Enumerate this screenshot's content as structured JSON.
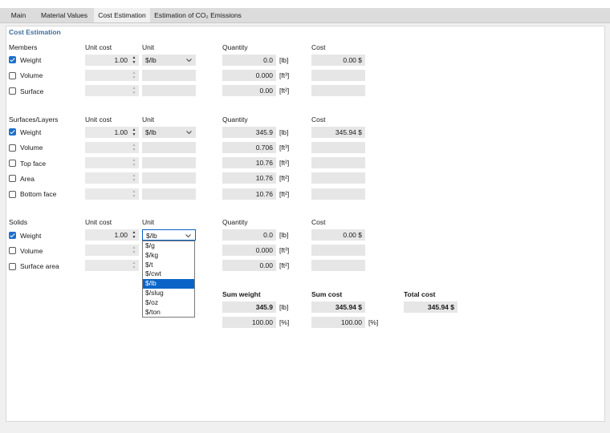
{
  "tabs": [
    {
      "label": "Main",
      "active": false
    },
    {
      "label": "Material Values",
      "active": false
    },
    {
      "label": "Cost Estimation",
      "active": true
    },
    {
      "label": "Estimation of CO₂ Emissions",
      "active": false
    }
  ],
  "panel_title": "Cost Estimation",
  "headers": {
    "unit_cost": "Unit cost",
    "unit": "Unit",
    "quantity": "Quantity",
    "cost": "Cost"
  },
  "members": {
    "title": "Members",
    "rows": [
      {
        "label": "Weight",
        "checked": true,
        "unit_cost": "1.00",
        "unit": "$/lb",
        "quantity": "0.0",
        "qty_unit": "[lb]",
        "cost": "0.00 $"
      },
      {
        "label": "Volume",
        "checked": false,
        "unit_cost": "",
        "unit": "",
        "quantity": "0.000",
        "qty_unit": "[ft³]",
        "cost": ""
      },
      {
        "label": "Surface",
        "checked": false,
        "unit_cost": "",
        "unit": "",
        "quantity": "0.00",
        "qty_unit": "[ft²]",
        "cost": ""
      }
    ]
  },
  "surfaces": {
    "title": "Surfaces/Layers",
    "rows": [
      {
        "label": "Weight",
        "checked": true,
        "unit_cost": "1.00",
        "unit": "$/lb",
        "quantity": "345.9",
        "qty_unit": "[lb]",
        "cost": "345.94 $"
      },
      {
        "label": "Volume",
        "checked": false,
        "unit_cost": "",
        "unit": "",
        "quantity": "0.706",
        "qty_unit": "[ft³]",
        "cost": ""
      },
      {
        "label": "Top face",
        "checked": false,
        "unit_cost": "",
        "unit": "",
        "quantity": "10.76",
        "qty_unit": "[ft²]",
        "cost": ""
      },
      {
        "label": "Area",
        "checked": false,
        "unit_cost": "",
        "unit": "",
        "quantity": "10.76",
        "qty_unit": "[ft²]",
        "cost": ""
      },
      {
        "label": "Bottom face",
        "checked": false,
        "unit_cost": "",
        "unit": "",
        "quantity": "10.76",
        "qty_unit": "[ft²]",
        "cost": ""
      }
    ]
  },
  "solids": {
    "title": "Solids",
    "rows": [
      {
        "label": "Weight",
        "checked": true,
        "unit_cost": "1.00",
        "unit": "$/lb",
        "quantity": "0.0",
        "qty_unit": "[lb]",
        "cost": "0.00 $"
      },
      {
        "label": "Volume",
        "checked": false,
        "unit_cost": "",
        "unit": "",
        "quantity": "0.000",
        "qty_unit": "[ft³]",
        "cost": ""
      },
      {
        "label": "Surface area",
        "checked": false,
        "unit_cost": "",
        "unit": "",
        "quantity": "0.00",
        "qty_unit": "[ft²]",
        "cost": ""
      }
    ]
  },
  "unit_dropdown": {
    "options": [
      "$/g",
      "$/kg",
      "$/t",
      "$/cwt",
      "$/lb",
      "$/slug",
      "$/oz",
      "$/ton"
    ],
    "selected": "$/lb"
  },
  "summary": {
    "sum_weight_label": "Sum weight",
    "sum_weight": "345.9",
    "sum_weight_unit": "[lb]",
    "sum_weight_pct": "100.00",
    "sum_cost_label": "Sum cost",
    "sum_cost": "345.94 $",
    "sum_cost_pct": "100.00",
    "pct_unit": "[%]",
    "total_cost_label": "Total cost",
    "total_cost": "345.94 $"
  },
  "colors": {
    "accent": "#1e6fcc",
    "title": "#3c6e9f",
    "field_bg": "#e6e6e6",
    "selected_bg": "#0a64c8"
  }
}
